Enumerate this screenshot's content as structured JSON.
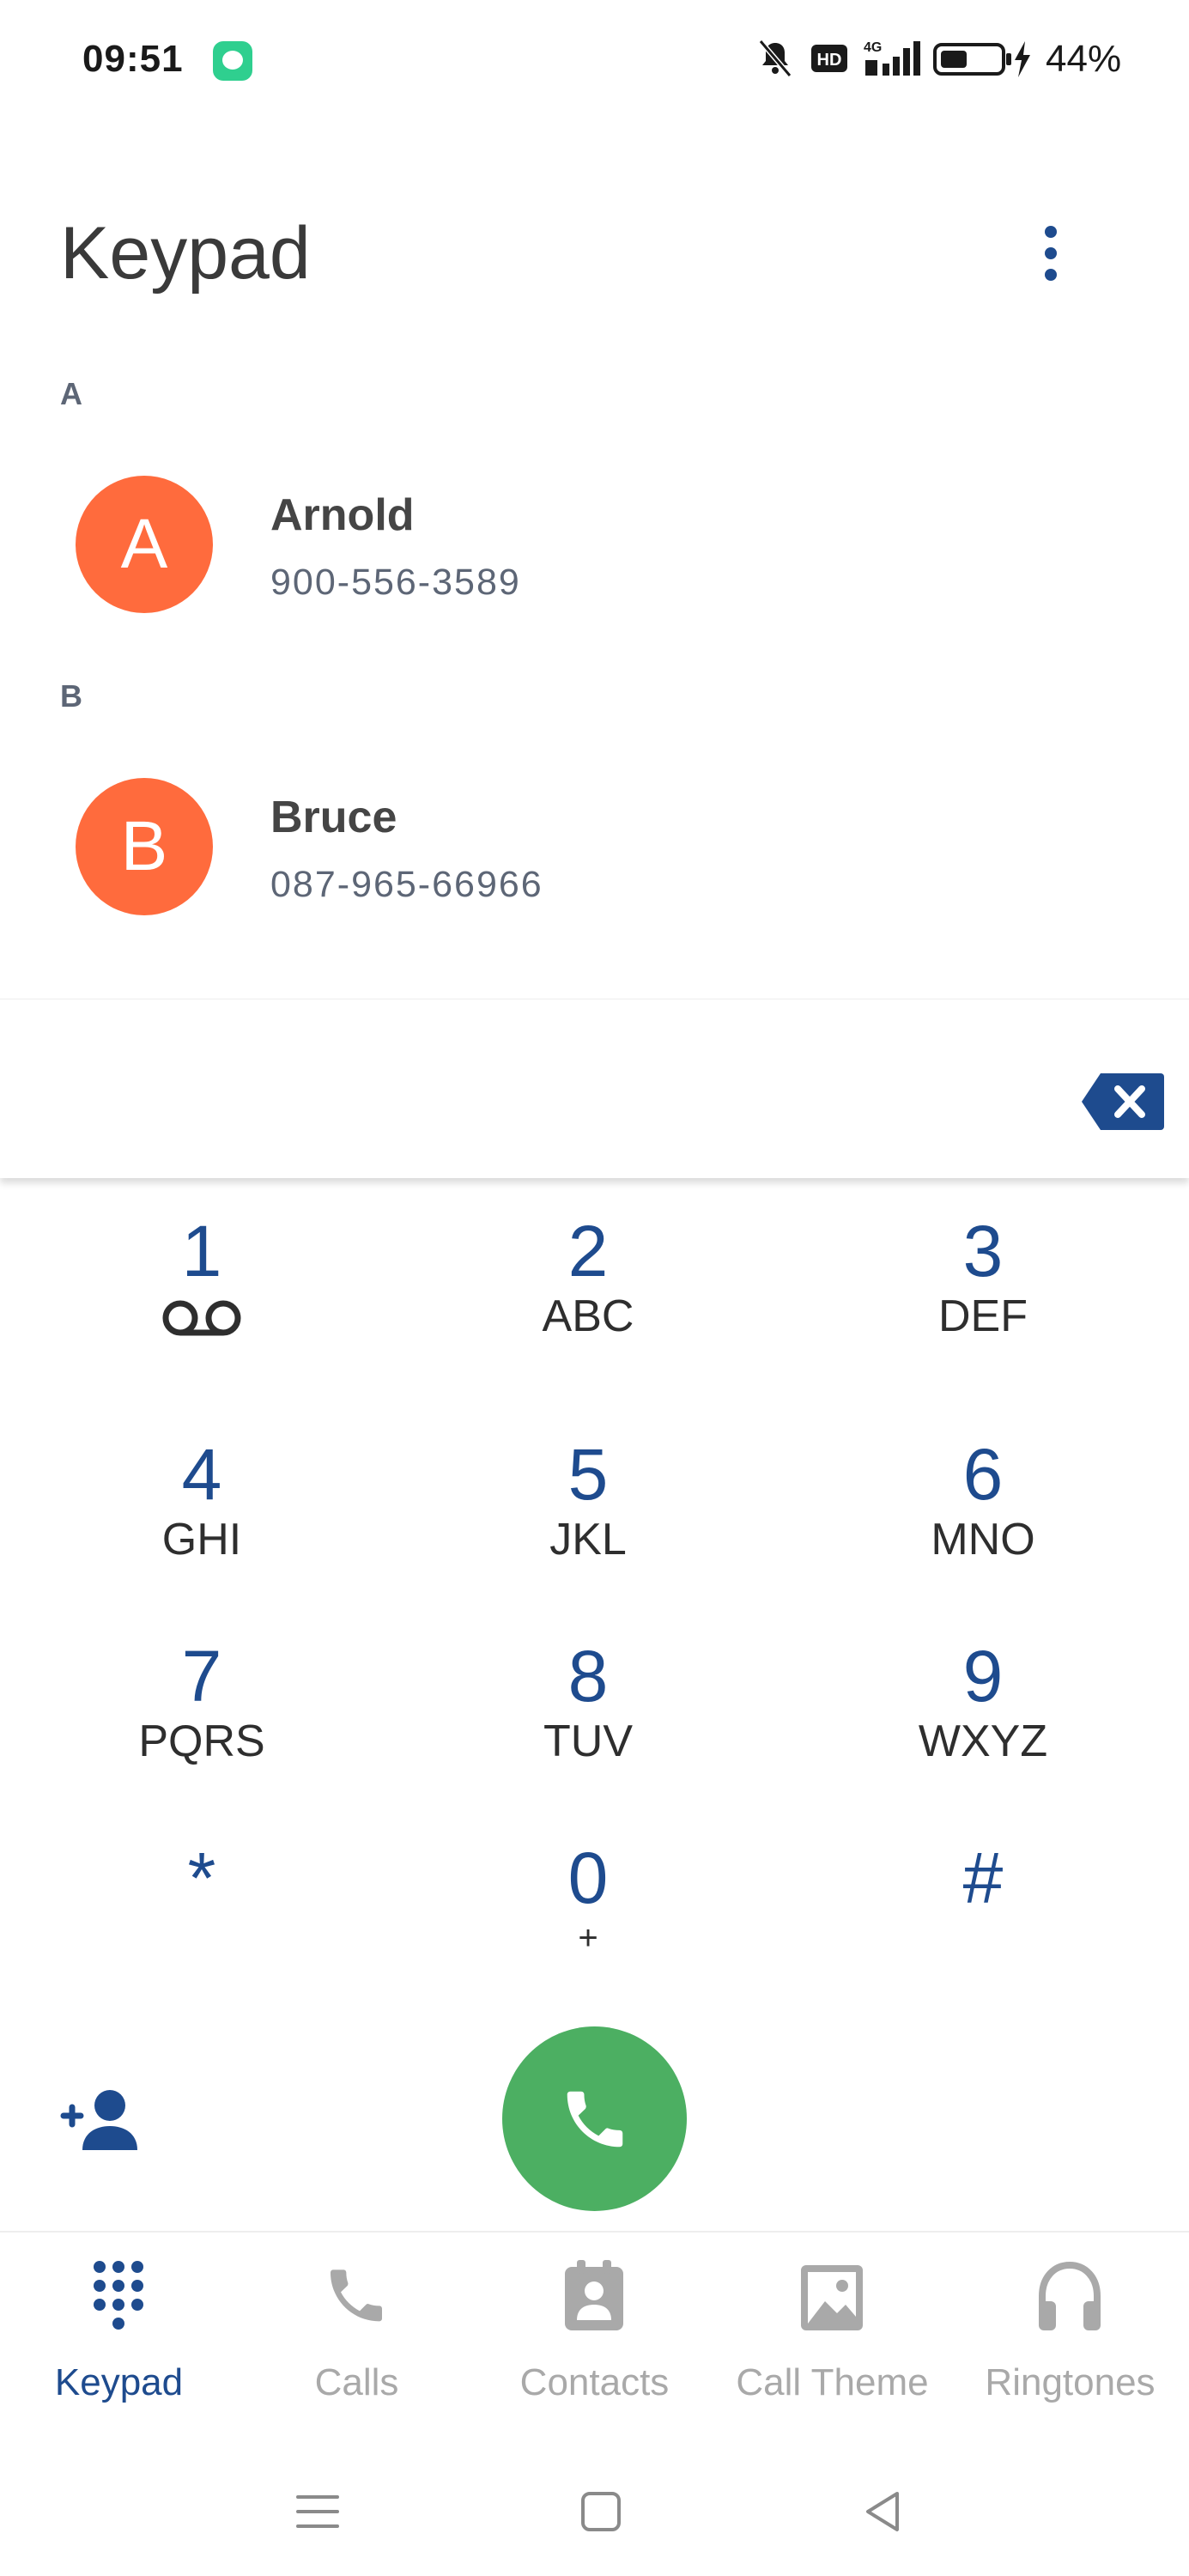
{
  "status_bar": {
    "time": "09:51",
    "network": "4G",
    "hd_label": "HD",
    "battery_percent": "44%"
  },
  "header": {
    "title": "Keypad"
  },
  "contacts": [
    {
      "section": "A",
      "initial": "A",
      "name": "Arnold",
      "number": "900-556-3589"
    },
    {
      "section": "B",
      "initial": "B",
      "name": "Bruce",
      "number": "087-965-66966"
    }
  ],
  "dialpad": {
    "input_value": "",
    "keys": [
      {
        "digit": "1",
        "letters": ""
      },
      {
        "digit": "2",
        "letters": "ABC"
      },
      {
        "digit": "3",
        "letters": "DEF"
      },
      {
        "digit": "4",
        "letters": "GHI"
      },
      {
        "digit": "5",
        "letters": "JKL"
      },
      {
        "digit": "6",
        "letters": "MNO"
      },
      {
        "digit": "7",
        "letters": "PQRS"
      },
      {
        "digit": "8",
        "letters": "TUV"
      },
      {
        "digit": "9",
        "letters": "WXYZ"
      },
      {
        "digit": "*",
        "letters": ""
      },
      {
        "digit": "0",
        "letters": "+"
      },
      {
        "digit": "#",
        "letters": ""
      }
    ]
  },
  "bottom_nav": {
    "items": [
      {
        "label": "Keypad",
        "icon": "dialpad-icon",
        "active": true
      },
      {
        "label": "Calls",
        "icon": "phone-icon",
        "active": false
      },
      {
        "label": "Contacts",
        "icon": "contacts-icon",
        "active": false
      },
      {
        "label": "Call Theme",
        "icon": "image-icon",
        "active": false
      },
      {
        "label": "Ringtones",
        "icon": "headphones-icon",
        "active": false
      }
    ]
  },
  "colors": {
    "accent": "#1e4b8e",
    "avatar": "#ff6b3d",
    "call_button": "#4caf62"
  }
}
